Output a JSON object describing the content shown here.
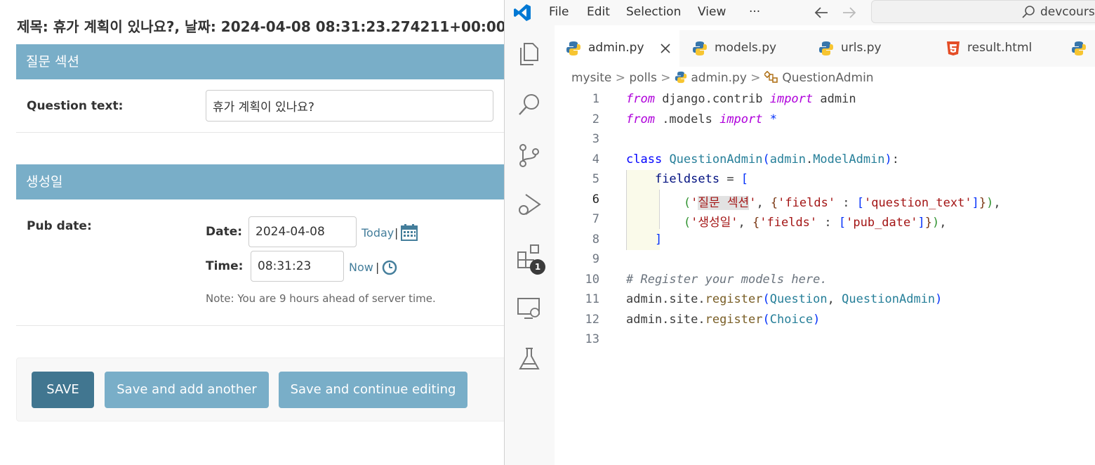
{
  "admin": {
    "title": "제목: 휴가 계획이 있나요?, 날짜: 2024-04-08 08:31:23.274211+00:00",
    "section1": {
      "header": "질문 섹션",
      "question_label": "Question text:",
      "question_value": "휴가 계획이 있나요?"
    },
    "section2": {
      "header": "생성일",
      "pub_label": "Pub date:",
      "date_label": "Date:",
      "date_value": "2024-04-08",
      "today": "Today",
      "time_label": "Time:",
      "time_value": "08:31:23",
      "now": "Now",
      "separator": "|",
      "note": "Note: You are 9 hours ahead of server time."
    },
    "buttons": {
      "save": "SAVE",
      "save_add": "Save and add another",
      "save_continue": "Save and continue editing"
    },
    "colors": {
      "header": "#79aec8",
      "save": "#417690",
      "secondary": "#79aec8"
    }
  },
  "vscode": {
    "menu": [
      "File",
      "Edit",
      "Selection",
      "View",
      "···"
    ],
    "search": "devcourse",
    "tabs": [
      {
        "label": "admin.py",
        "active": true
      },
      {
        "label": "models.py"
      },
      {
        "label": "urls.py"
      },
      {
        "label": "result.html"
      }
    ],
    "breadcrumb": {
      "folder1": "mysite",
      "folder2": "polls",
      "file": "admin.py",
      "symbol": "QuestionAdmin",
      "sep": ">"
    },
    "extensions_badge": "1",
    "code_lines": [
      "from django.contrib import admin",
      "from .models import *",
      "",
      "class QuestionAdmin(admin.ModelAdmin):",
      "    fieldsets = [",
      "        ('질문 섹션', {'fields' : ['question_text']}),",
      "        ('생성일', {'fields' : ['pub_date']}),",
      "    ]",
      "",
      "# Register your models here.",
      "admin.site.register(Question, QuestionAdmin)",
      "admin.site.register(Choice)",
      ""
    ],
    "line_numbers": [
      "1",
      "2",
      "3",
      "4",
      "5",
      "6",
      "7",
      "8",
      "9",
      "10",
      "11",
      "12",
      "13"
    ],
    "active_line": 6
  }
}
